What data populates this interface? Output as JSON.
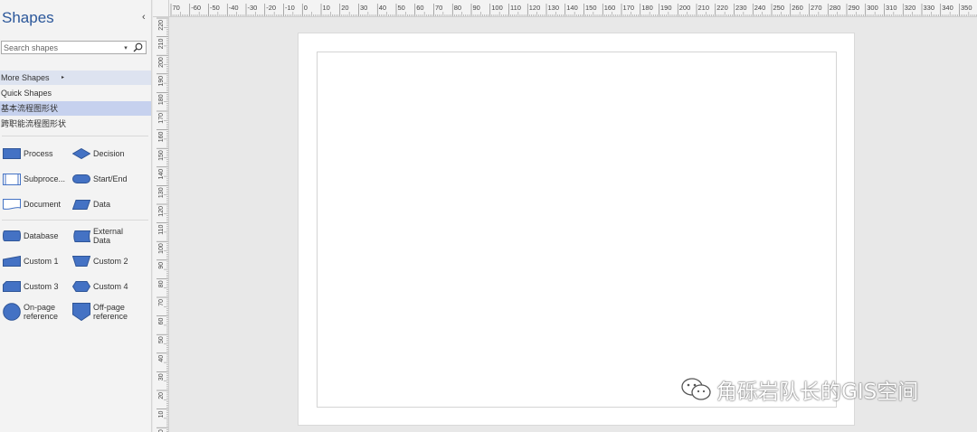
{
  "pane": {
    "title": "Shapes",
    "collapse_glyph": "‹",
    "search": {
      "placeholder": "Search shapes",
      "dropdown_glyph": "▾",
      "button_icon": "search-icon"
    }
  },
  "categories": {
    "more_shapes": {
      "label": "More Shapes",
      "arrow_glyph": "▸"
    },
    "quick_shapes": {
      "label": "Quick Shapes"
    },
    "basic_flowchart": {
      "label": "基本流程图形状",
      "selected": true
    },
    "cross_functional": {
      "label": "跨职能流程图形状"
    }
  },
  "stencils": [
    {
      "label": "Process",
      "icon": "process-shape-icon"
    },
    {
      "label": "Decision",
      "icon": "decision-shape-icon"
    },
    {
      "label": "Subproce...",
      "icon": "subprocess-shape-icon"
    },
    {
      "label": "Start/End",
      "icon": "start-end-shape-icon"
    },
    {
      "label": "Document",
      "icon": "document-shape-icon"
    },
    {
      "label": "Data",
      "icon": "data-shape-icon"
    },
    {
      "label": "Database",
      "icon": "database-shape-icon"
    },
    {
      "label": "External Data",
      "label_lines": [
        "External",
        "Data"
      ],
      "icon": "external-data-shape-icon"
    },
    {
      "label": "Custom 1",
      "icon": "custom-1-shape-icon"
    },
    {
      "label": "Custom 2",
      "icon": "custom-2-shape-icon"
    },
    {
      "label": "Custom 3",
      "icon": "custom-3-shape-icon"
    },
    {
      "label": "Custom 4",
      "icon": "custom-4-shape-icon"
    },
    {
      "label": "On-page reference",
      "label_lines": [
        "On-page",
        "reference"
      ],
      "icon": "on-page-reference-icon"
    },
    {
      "label": "Off-page reference",
      "label_lines": [
        "Off-page",
        "reference"
      ],
      "icon": "off-page-reference-icon"
    }
  ],
  "rulers": {
    "horizontal_labels": [
      "70",
      "-60",
      "-50",
      "-40",
      "-30",
      "-20",
      "-10",
      "0",
      "10",
      "20",
      "30",
      "40",
      "50",
      "60",
      "70",
      "80",
      "90",
      "100",
      "110",
      "120",
      "130",
      "140",
      "150",
      "160",
      "170",
      "180",
      "190",
      "200",
      "210",
      "220",
      "230",
      "240",
      "250",
      "260",
      "270",
      "280",
      "290",
      "300",
      "310",
      "320",
      "330",
      "340",
      "350"
    ],
    "vertical_labels": [
      "220",
      "210",
      "200",
      "190",
      "180",
      "170",
      "160",
      "150",
      "140",
      "130",
      "120",
      "110",
      "100",
      "90",
      "80",
      "70",
      "60",
      "50",
      "40",
      "30",
      "20",
      "10",
      "0"
    ]
  },
  "watermark": {
    "text": "角砾岩队长的GIS空间",
    "icon": "wechat-icon"
  },
  "colors": {
    "shape_fill": "#4472c4",
    "shape_stroke": "#2f5597",
    "title": "#2b579a",
    "selected_category": "#c6d1ee"
  }
}
